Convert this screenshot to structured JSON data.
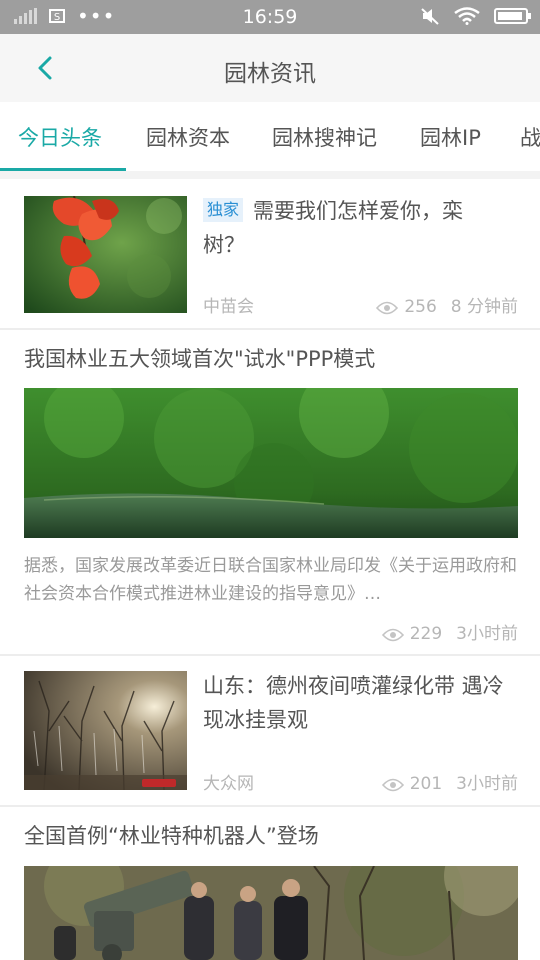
{
  "status_bar": {
    "time": "16:59",
    "sim_label": "S",
    "battery_level": 0.92
  },
  "header": {
    "title": "园林资讯"
  },
  "tabs": [
    "今日头条",
    "园林资本",
    "园林搜神记",
    "园林IP",
    "战"
  ],
  "articles": [
    {
      "tag": "独家",
      "title": "需要我们怎样爱你，栾树？",
      "source": "中苗会",
      "views": "256",
      "time": "8 分钟前"
    },
    {
      "title": "我国林业五大领域首次\"试水\"PPP模式",
      "summary": "据悉，国家发展改革委近日联合国家林业局印发《关于运用政府和社会资本合作模式推进林业建设的指导意见》…",
      "views": "229",
      "time": "3小时前"
    },
    {
      "title": "山东：德州夜间喷灌绿化带 遇冷现冰挂景观",
      "source": "大众网",
      "views": "201",
      "time": "3小时前"
    },
    {
      "title": "全国首例“林业特种机器人”登场"
    }
  ]
}
